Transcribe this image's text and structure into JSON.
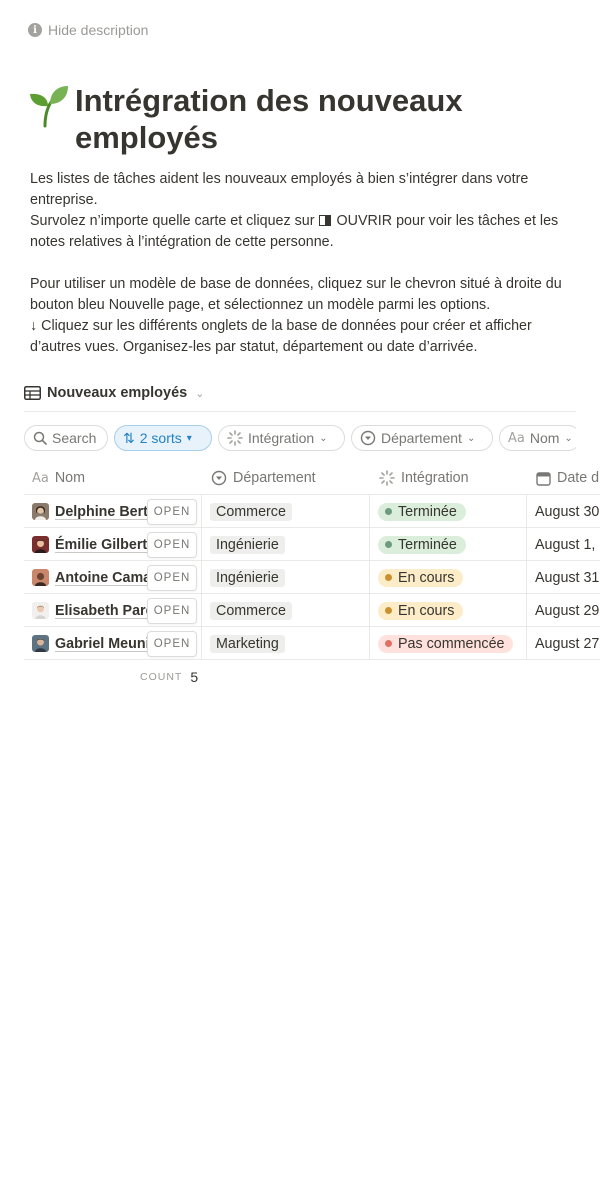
{
  "description_toggle": {
    "label": "Hide description"
  },
  "page": {
    "title": "Intrégration des nouveaux employés"
  },
  "description": {
    "line1": "Les listes de tâches aident les nouveaux employés à bien s’intégrer dans votre entreprise.",
    "line2_before": "Survolez n’importe quelle carte et cliquez sur",
    "line2_open": "OUVRIR",
    "line2_after": "pour voir les tâches et les notes relatives à l’intégration de cette personne.",
    "line3": "Pour utiliser un modèle de base de données, cliquez sur le chevron situé à droite du bouton bleu Nouvelle page, et sélectionnez un modèle parmi les options.",
    "line4": "↓ Cliquez sur les différents onglets de la base de données pour créer et afficher d’autres vues. Organisez-les par statut, département ou date d’arrivée."
  },
  "database": {
    "view_title": "Nouveaux employés",
    "filters": {
      "search": "Search",
      "sorts": "2 sorts",
      "integration": "Intégration",
      "department": "Département",
      "name": "Nom"
    },
    "columns": {
      "name": "Nom",
      "department": "Département",
      "integration": "Intégration",
      "date": "Date d"
    },
    "open_label": "OPEN",
    "rows": [
      {
        "name": "Delphine Bertr",
        "department": "Commerce",
        "status": "Terminée",
        "date": "August 30"
      },
      {
        "name": "Émilie Gilbert",
        "department": "Ingénierie",
        "status": "Terminée",
        "date": "August 1,"
      },
      {
        "name": "Antoine Cama",
        "department": "Ingénierie",
        "status": "En cours",
        "date": "August 31"
      },
      {
        "name": "Elisabeth Pare",
        "department": "Commerce",
        "status": "En cours",
        "date": "August 29"
      },
      {
        "name": "Gabriel Meuni",
        "department": "Marketing",
        "status": "Pas commencée",
        "date": "August 27"
      }
    ],
    "count": {
      "label": "COUNT",
      "value": "5"
    }
  },
  "colors": {
    "done_bg": "#dbeddb",
    "done_dot": "#6c9b7d",
    "progress_bg": "#fdecc8",
    "progress_dot": "#cb912f",
    "notstarted_bg": "#ffe2dd",
    "notstarted_dot": "#e16f64",
    "accent": "#2383c4"
  }
}
